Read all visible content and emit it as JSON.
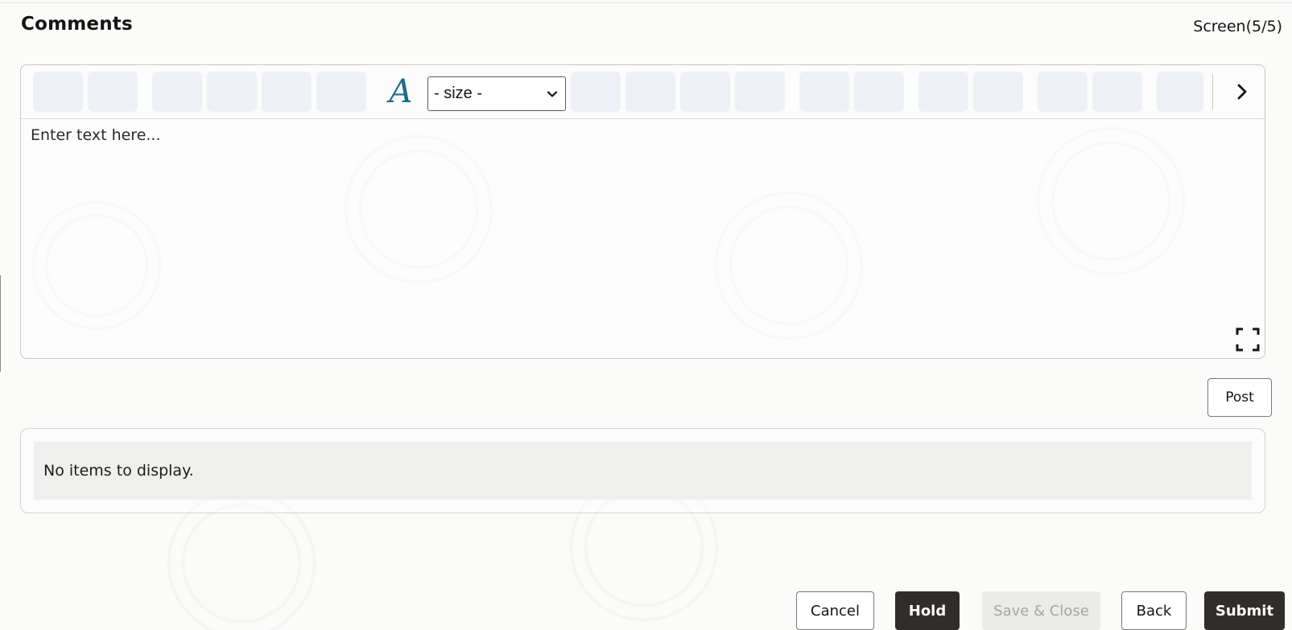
{
  "header": {
    "title": "Comments",
    "screen_indicator": "Screen(5/5)"
  },
  "editor": {
    "size_select": {
      "selected": "- size -"
    },
    "font_color_glyph": "A",
    "placeholder": "Enter text here..."
  },
  "post_label": "Post",
  "list": {
    "empty_message": "No items to display."
  },
  "footer": {
    "cancel": "Cancel",
    "hold": "Hold",
    "save_close": "Save & Close",
    "back": "Back",
    "submit": "Submit"
  },
  "colors": {
    "accent_icon": "#1c6a86",
    "primary_button": "#312d2a",
    "disabled_button": "#ebebea"
  }
}
